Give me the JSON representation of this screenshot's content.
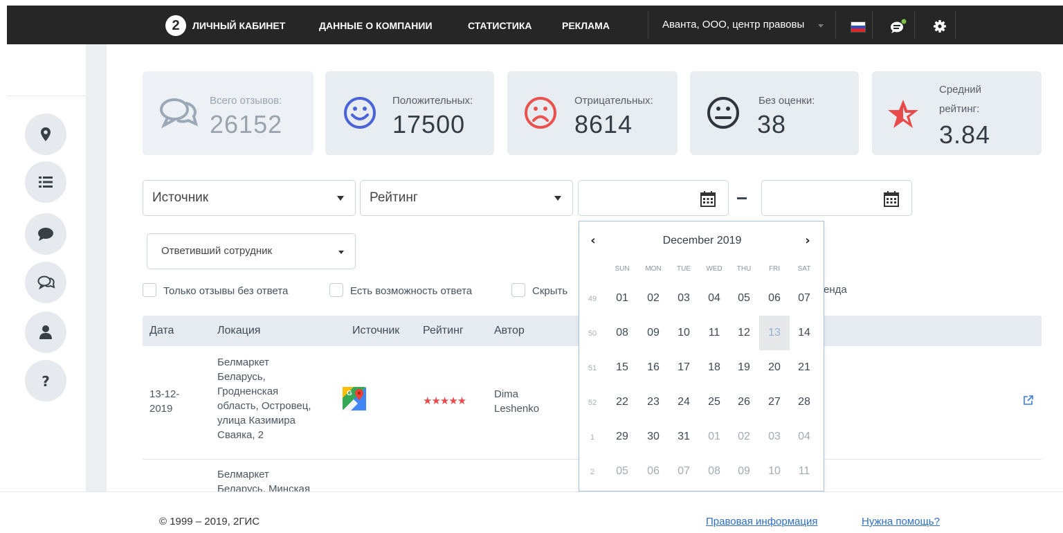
{
  "topbar": {
    "logo": "2",
    "nav": [
      "ЛИЧНЫЙ КАБИНЕТ",
      "ДАННЫЕ О КОМПАНИИ",
      "СТАТИСТИКА",
      "РЕКЛАМА"
    ],
    "company": "Аванта, ООО, центр правовы"
  },
  "stats": {
    "total_label": "Всего отзывов:",
    "total_value": "26152",
    "positive_label": "Положительных:",
    "positive_value": "17500",
    "negative_label": "Отрицательных:",
    "negative_value": "8614",
    "neutral_label": "Без оценки:",
    "neutral_value": "38",
    "rating_label_1": "Средний",
    "rating_label_2": "рейтинг:",
    "rating_value": "3.84"
  },
  "filters": {
    "source": "Источник",
    "rating": "Рейтинг",
    "employee": "Ответивший сотрудник",
    "checkbox_no_answer": "Только отзывы без ответа",
    "checkbox_can_answer": "Есть возможность ответа",
    "checkbox_hide": "Скрыть",
    "checkbox_tail": "енда"
  },
  "table": {
    "headers": [
      "Дата",
      "Локация",
      "Источник",
      "Рейтинг",
      "Автор"
    ],
    "row1": {
      "date_1": "13-12-",
      "date_2": "2019",
      "location": [
        "Белмаркет",
        "Беларусь,",
        "Гродненская",
        "область, Островец,",
        "улица Казимира",
        "Сваяка, 2"
      ],
      "stars": "★★★★★",
      "author_1": "Dima",
      "author_2": "Leshenko"
    },
    "row2": {
      "location_1": "Белмаркет",
      "location_2": "Беларусь, Минская"
    }
  },
  "datepicker": {
    "month": "December 2019",
    "prev": "‹",
    "next": "›",
    "dow": [
      "SUN",
      "MON",
      "TUE",
      "WED",
      "THU",
      "FRI",
      "SAT"
    ],
    "weeks": [
      {
        "num": "49",
        "days": [
          "01",
          "02",
          "03",
          "04",
          "05",
          "06",
          "07"
        ]
      },
      {
        "num": "50",
        "days": [
          "08",
          "09",
          "10",
          "11",
          "12",
          "13",
          "14"
        ]
      },
      {
        "num": "51",
        "days": [
          "15",
          "16",
          "17",
          "18",
          "19",
          "20",
          "21"
        ]
      },
      {
        "num": "52",
        "days": [
          "22",
          "23",
          "24",
          "25",
          "26",
          "27",
          "28"
        ]
      },
      {
        "num": "1",
        "days": [
          "29",
          "30",
          "31",
          "01",
          "02",
          "03",
          "04"
        ]
      },
      {
        "num": "2",
        "days": [
          "05",
          "06",
          "07",
          "08",
          "09",
          "10",
          "11"
        ]
      }
    ]
  },
  "footer": {
    "copyright": "© 1999 – 2019, 2ГИС",
    "legal": "Правовая информация",
    "help": "Нужна помощь?"
  },
  "colors": {
    "topbar": "#262626",
    "positive": "#4b63d6",
    "negative": "#e8524f",
    "star": "#e84a4a",
    "link": "#2e6ec3"
  }
}
